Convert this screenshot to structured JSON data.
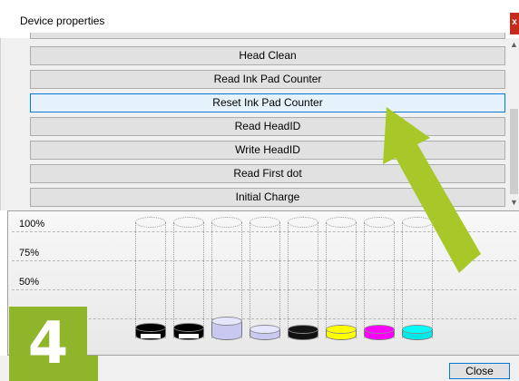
{
  "window": {
    "title": "Device properties",
    "close_glyph": "x"
  },
  "commands": [
    {
      "label": "Head Clean"
    },
    {
      "label": "Read Ink Pad Counter"
    },
    {
      "label": "Reset Ink Pad Counter"
    },
    {
      "label": "Read HeadID"
    },
    {
      "label": "Write HeadID"
    },
    {
      "label": "Read First dot"
    },
    {
      "label": "Initial Charge"
    }
  ],
  "ink_levels": {
    "axis": [
      "100%",
      "75%",
      "50%"
    ],
    "tanks": [
      {
        "color": "#000000",
        "level": 0.06,
        "cap_color": "#000000"
      },
      {
        "color": "#000000",
        "level": 0.06,
        "cap_color": "#000000"
      },
      {
        "color": "#c8c8f0",
        "level": 0.12,
        "cap_color": "#c8c8f0"
      },
      {
        "color": "#c8c8f0",
        "level": 0.05,
        "cap_color": "#c8c8f0"
      },
      {
        "color": "#111111",
        "level": 0.05,
        "cap_color": "#111111"
      },
      {
        "color": "#ffff00",
        "level": 0.05,
        "cap_color": "#ffff00"
      },
      {
        "color": "#ff00ff",
        "level": 0.05,
        "cap_color": "#ff00ff"
      },
      {
        "color": "#00e8e8",
        "level": 0.05,
        "cap_color": "#00e8e8"
      }
    ]
  },
  "overlay": {
    "step_number": "4",
    "badge_color": "#8fb52a",
    "arrow_color": "#a8c82a"
  },
  "footer": {
    "close_label": "Close"
  }
}
